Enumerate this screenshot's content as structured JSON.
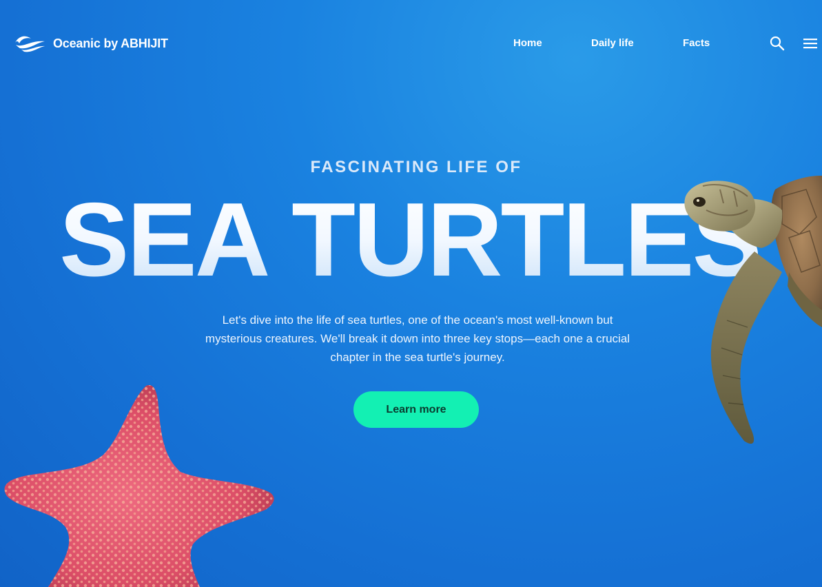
{
  "header": {
    "brand": "Oceanic by ABHIJIT",
    "logo_icon": "wave-logo-icon",
    "nav": [
      {
        "label": "Home"
      },
      {
        "label": "Daily life"
      },
      {
        "label": "Facts"
      }
    ],
    "search_icon": "search-icon",
    "menu_icon": "hamburger-menu-icon"
  },
  "hero": {
    "eyebrow": "FASCINATING LIFE OF",
    "title": "SEA TURTLES",
    "description": "Let's dive into the life of sea turtles, one of the ocean's most well-known but mysterious creatures. We'll break it down into three key stops—each one a crucial chapter in the sea turtle's journey.",
    "cta_label": "Learn more"
  },
  "colors": {
    "background": "#1a82e0",
    "accent": "#13f0b3",
    "cta_text": "#0b3b2f",
    "starfish": "#e0566f",
    "turtle": "#8a7a55"
  }
}
